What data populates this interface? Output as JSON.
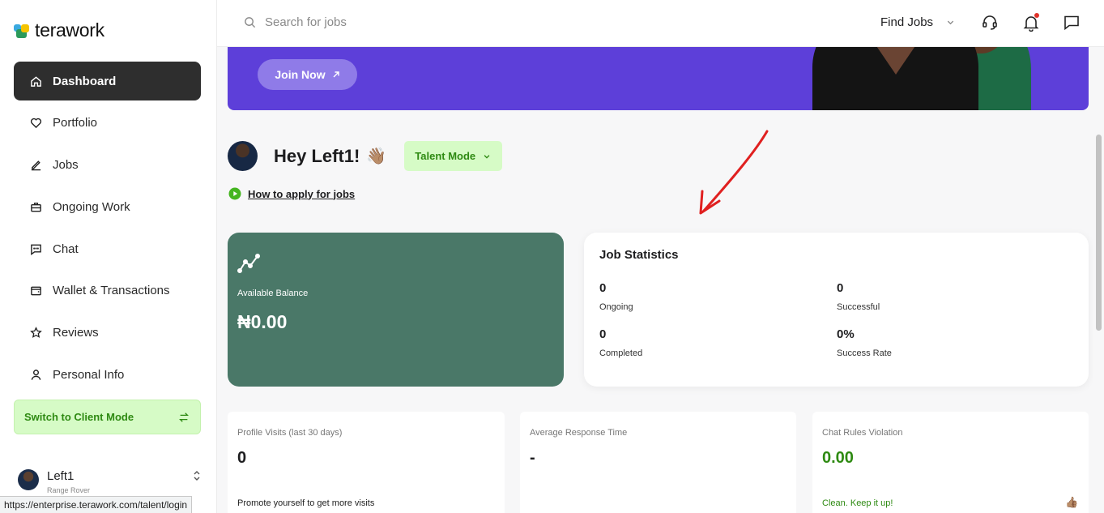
{
  "brand": {
    "name": "terawork"
  },
  "sidebar": {
    "items": [
      {
        "label": "Dashboard",
        "icon": "home-icon"
      },
      {
        "label": "Portfolio",
        "icon": "heart-icon"
      },
      {
        "label": "Jobs",
        "icon": "pencil-icon"
      },
      {
        "label": "Ongoing Work",
        "icon": "briefcase-icon"
      },
      {
        "label": "Chat",
        "icon": "chat-icon"
      },
      {
        "label": "Wallet & Transactions",
        "icon": "wallet-icon"
      },
      {
        "label": "Reviews",
        "icon": "star-icon"
      },
      {
        "label": "Personal Info",
        "icon": "user-icon"
      }
    ],
    "switch_label": "Switch to Client Mode",
    "user": {
      "name": "Left1",
      "subtitle": "Range Rover"
    }
  },
  "status_url": "https://enterprise.terawork.com/talent/login",
  "topbar": {
    "search_placeholder": "Search for jobs",
    "find_jobs": "Find Jobs"
  },
  "banner": {
    "join_label": "Join Now"
  },
  "greeting": {
    "text": "Hey Left1!",
    "emoji": "👋🏽",
    "mode_label": "Talent Mode",
    "how_to": "How to apply for jobs"
  },
  "balance": {
    "label": "Available Balance",
    "value": "₦0.00"
  },
  "job_stats": {
    "title": "Job Statistics",
    "ongoing": {
      "value": "0",
      "label": "Ongoing"
    },
    "successful": {
      "value": "0",
      "label": "Successful"
    },
    "completed": {
      "value": "0",
      "label": "Completed"
    },
    "success_rate": {
      "value": "0%",
      "label": "Success Rate"
    }
  },
  "cards": {
    "profile_visits": {
      "label": "Profile Visits (last 30 days)",
      "value": "0",
      "foot": "Promote yourself to get more visits"
    },
    "response_time": {
      "label": "Average Response Time",
      "value": "-"
    },
    "violation": {
      "label": "Chat Rules Violation",
      "value": "0.00",
      "foot": "Clean. Keep it up!",
      "emoji": "👍🏽"
    }
  },
  "colors": {
    "accent_green": "#2e8a12",
    "banner_purple": "#5d3fd9",
    "balance_card": "#4a7868",
    "active_nav": "#2e2e2e"
  }
}
